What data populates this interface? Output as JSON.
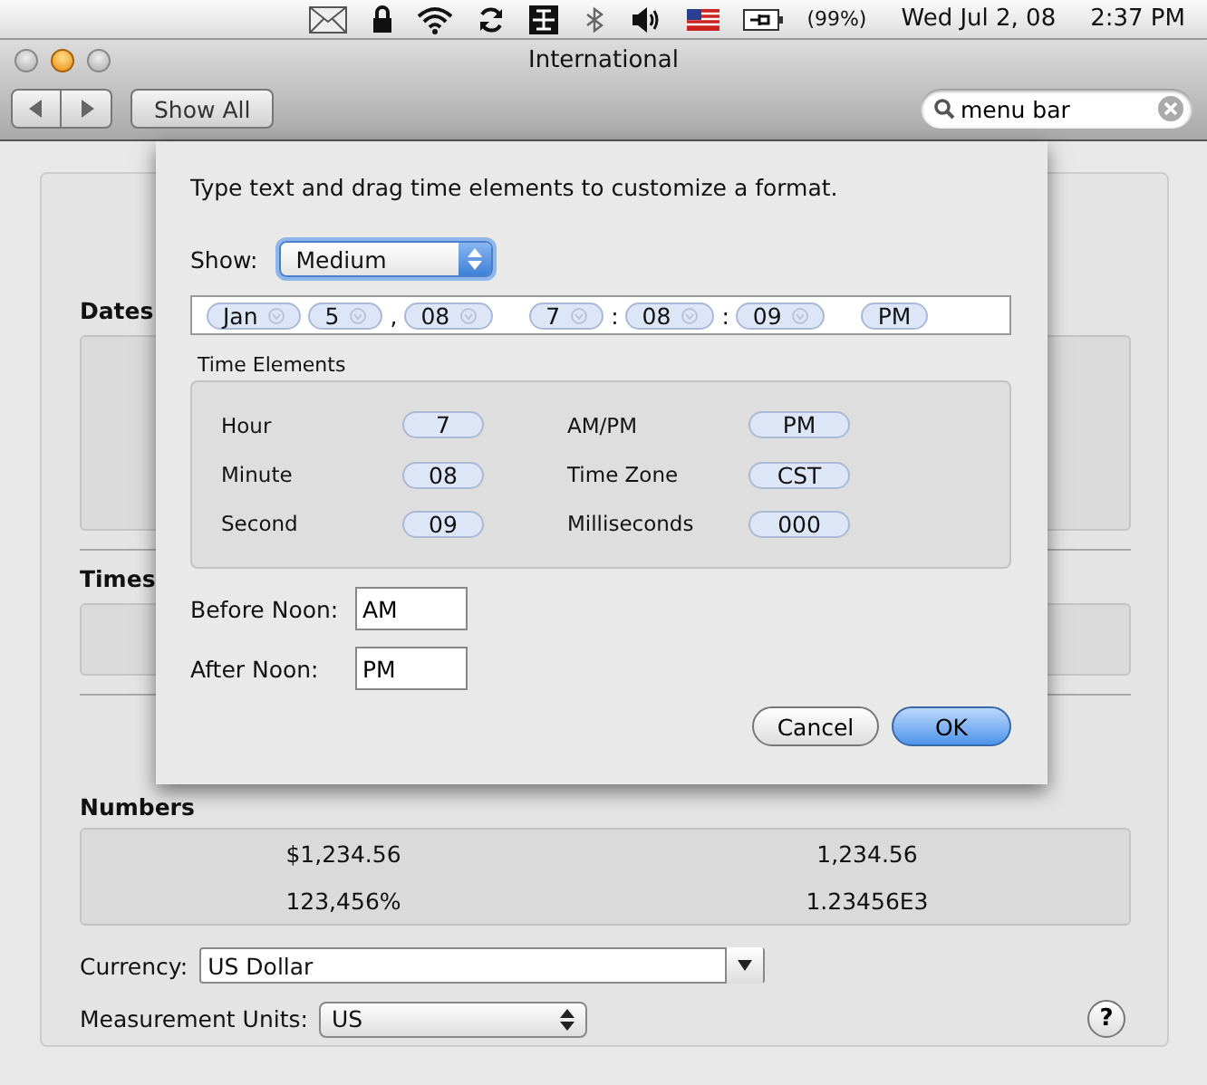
{
  "menu_bar": {
    "battery": "(99%)",
    "date": "Wed Jul 2, 08",
    "time": "2:37 PM"
  },
  "window": {
    "title": "International"
  },
  "toolbar": {
    "show_all": "Show All",
    "search": {
      "value": "menu bar"
    }
  },
  "sections": [
    "Dates",
    "Times",
    "Numbers"
  ],
  "number_samples": [
    "$1,234.56",
    "1,234.56",
    "123,456%",
    "1.23456E3"
  ],
  "currency": {
    "label": "Currency:",
    "value": "US Dollar"
  },
  "measurement": {
    "label": "Measurement Units:",
    "value": "US"
  },
  "help": "?",
  "sheet": {
    "instruction": "Type text and drag time elements to customize a format.",
    "show": {
      "label": "Show:",
      "value": "Medium"
    },
    "format": [
      {
        "kind": "token",
        "text": "Jan",
        "menu": true
      },
      {
        "kind": "token",
        "text": "5",
        "menu": true
      },
      {
        "kind": "separator",
        "text": ","
      },
      {
        "kind": "token",
        "text": "08",
        "menu": true
      },
      {
        "kind": "space"
      },
      {
        "kind": "token",
        "text": "7",
        "menu": true
      },
      {
        "kind": "separator",
        "text": ":"
      },
      {
        "kind": "token",
        "text": "08",
        "menu": true
      },
      {
        "kind": "separator",
        "text": ":"
      },
      {
        "kind": "token",
        "text": "09",
        "menu": true
      },
      {
        "kind": "space"
      },
      {
        "kind": "token",
        "text": "PM",
        "menu": false
      }
    ],
    "time_elements": {
      "title": "Time Elements",
      "items": [
        {
          "label": "Hour",
          "value": "7"
        },
        {
          "label": "AM/PM",
          "value": "PM"
        },
        {
          "label": "Minute",
          "value": "08"
        },
        {
          "label": "Time Zone",
          "value": "CST"
        },
        {
          "label": "Second",
          "value": "09"
        },
        {
          "label": "Milliseconds",
          "value": "000"
        }
      ]
    },
    "before_noon": {
      "label": "Before Noon:",
      "value": "AM"
    },
    "after_noon": {
      "label": "After Noon:",
      "value": "PM"
    },
    "buttons": [
      {
        "label": "Cancel",
        "default": false
      },
      {
        "label": "OK",
        "default": true
      }
    ]
  }
}
